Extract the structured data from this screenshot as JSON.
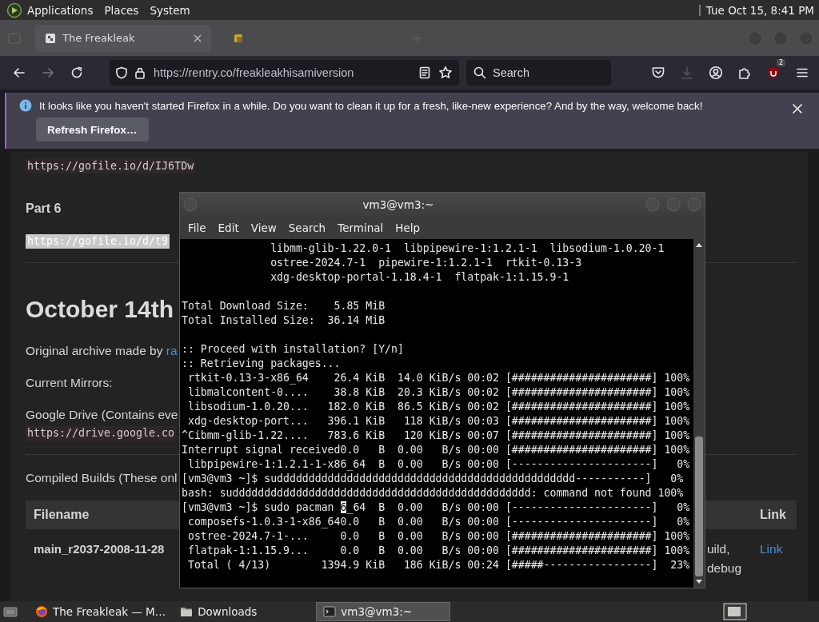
{
  "top_panel": {
    "menus": [
      "Applications",
      "Places",
      "System"
    ],
    "clock": "Tue Oct 15, 8:41 PM"
  },
  "browser": {
    "tabs": [
      {
        "title": "The Freakleak",
        "selected": true,
        "kind": "site"
      },
      {
        "selected": false,
        "kind": "page"
      }
    ],
    "forward_disabled": true,
    "address": "https://rentry.co/freakleakhisamiversion",
    "search": {
      "placeholder": "Search"
    },
    "extension_badge": "2",
    "notification": {
      "message": "It looks like you haven't started Firefox in a while. Do you want to clean it up for a fresh, like-new experience? And by the way, welcome back!",
      "button": "Refresh Firefox…"
    }
  },
  "page": {
    "blocks": [
      {
        "kind": "code",
        "text": "https://gofile.io/d/IJ6TDw",
        "selected": false
      },
      {
        "kind": "label",
        "text": "Part 6"
      },
      {
        "kind": "code",
        "text": "https://gofile.io/d/t9",
        "selected": true
      },
      {
        "kind": "rule"
      },
      {
        "kind": "heading",
        "text": "October 14th"
      },
      {
        "kind": "text",
        "text": "Original archive made by ",
        "link": "ra"
      },
      {
        "kind": "text",
        "text": "Current Mirrors:"
      },
      {
        "kind": "text",
        "text": "Google Drive (Contains eve"
      },
      {
        "kind": "code",
        "text": "https://drive.google.co",
        "selected": false
      },
      {
        "kind": "rule"
      },
      {
        "kind": "text",
        "text": "Compiled Builds (These onl"
      }
    ],
    "table": {
      "columns": [
        "Filename",
        "Link"
      ],
      "rows": [
        {
          "filename": "main_r2037-2008-11-28",
          "description": [
            "uild,",
            "debug"
          ],
          "link": "Link"
        }
      ]
    }
  },
  "terminal": {
    "title": "vm3@vm3:~",
    "menus": [
      "File",
      "Edit",
      "View",
      "Search",
      "Terminal",
      "Help"
    ],
    "lines": [
      {
        "kind": "text",
        "text": "              libmm-glib-1.22.0-1  libpipewire-1:1.2.1-1  libsodium-1.0.20-1"
      },
      {
        "kind": "text",
        "text": "              ostree-2024.7-1  pipewire-1:1.2.1-1  rtkit-0.13-3"
      },
      {
        "kind": "text",
        "text": "              xdg-desktop-portal-1.18.4-1  flatpak-1:1.15.9-1"
      },
      {
        "kind": "blank"
      },
      {
        "kind": "text",
        "text": "Total Download Size:    5.85 MiB"
      },
      {
        "kind": "text",
        "text": "Total Installed Size:  36.14 MiB"
      },
      {
        "kind": "blank"
      },
      {
        "kind": "text",
        "text": ":: Proceed with installation? [Y/n]"
      },
      {
        "kind": "text",
        "text": ":: Retrieving packages..."
      },
      {
        "kind": "text",
        "text": " rtkit-0.13-3-x86_64    26.4 KiB  14.0 KiB/s 00:02 [######################] 100%"
      },
      {
        "kind": "text",
        "text": " libmalcontent-0....    38.8 KiB  20.3 KiB/s 00:02 [######################] 100%"
      },
      {
        "kind": "text",
        "text": " libsodium-1.0.20...   182.0 KiB  86.5 KiB/s 00:02 [######################] 100%"
      },
      {
        "kind": "text",
        "text": " xdg-desktop-port...   396.1 KiB   118 KiB/s 00:03 [######################] 100%"
      },
      {
        "kind": "text",
        "text": "^Cibmm-glib-1.22....   783.6 KiB   120 KiB/s 00:07 [######################] 100%"
      },
      {
        "kind": "text",
        "text": "Interrupt signal received0.0   B  0.00   B/s 00:00 [######################] 100%"
      },
      {
        "kind": "text",
        "text": " libpipewire-1:1.2.1-1-x86_64  B  0.00   B/s 00:00 [----------------------]   0%"
      },
      {
        "kind": "text",
        "text": "[vm3@vm3 ~]$ suddddddddddddddddddddddddddddddddddddddddddddddd-----------]   0%"
      },
      {
        "kind": "text",
        "text": "bash: suddddddddddddddddddddddddddddddddddddddddddddddd: command not found 100%"
      },
      {
        "kind": "cursor",
        "text": "[vm3@vm3 ~]$ sudo pacman ",
        "cursor": "6",
        "after": "_64  B  0.00   B/s 00:00 [----------------------]   0%"
      },
      {
        "kind": "text",
        "text": " composefs-1.0.3-1-x86_640.0   B  0.00   B/s 00:00 [----------------------]   0%"
      },
      {
        "kind": "text",
        "text": " ostree-2024.7-1-...     0.0   B  0.00   B/s 00:00 [######################] 100%"
      },
      {
        "kind": "text",
        "text": " flatpak-1:1.15.9...     0.0   B  0.00   B/s 00:00 [######################] 100%"
      },
      {
        "kind": "text",
        "text": " Total ( 4/13)        1394.9 KiB   186 KiB/s 00:24 [#####-----------------]  23%"
      }
    ]
  },
  "taskbar": {
    "tasks": [
      {
        "kind": "browser",
        "label": "The Freakleak — M…",
        "selected": false
      },
      {
        "kind": "folder",
        "label": "Downloads",
        "selected": false
      },
      {
        "kind": "terminal",
        "label": "vm3@vm3:~",
        "selected": true
      }
    ]
  }
}
